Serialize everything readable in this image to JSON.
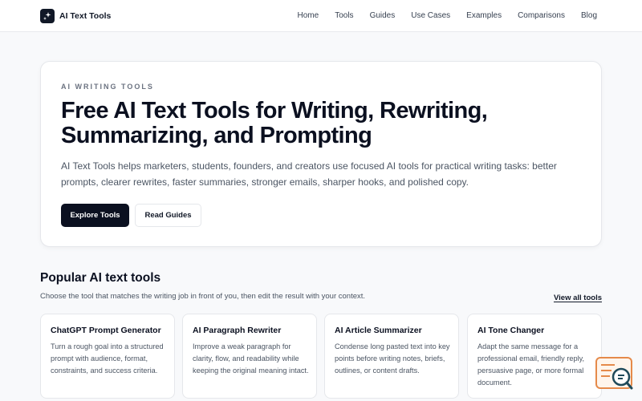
{
  "header": {
    "brand": "AI Text Tools",
    "nav": [
      "Home",
      "Tools",
      "Guides",
      "Use Cases",
      "Examples",
      "Comparisons",
      "Blog"
    ]
  },
  "hero": {
    "eyebrow": "AI WRITING TOOLS",
    "title": "Free AI Text Tools for Writing, Rewriting, Summarizing, and Prompting",
    "description": "AI Text Tools helps marketers, students, founders, and creators use focused AI tools for practical writing tasks: better prompts, clearer rewrites, faster summaries, stronger emails, sharper hooks, and polished copy.",
    "primary_button": "Explore Tools",
    "secondary_button": "Read Guides"
  },
  "popular": {
    "title": "Popular AI text tools",
    "description": "Choose the tool that matches the writing job in front of you, then edit the result with your context.",
    "view_all": "View all tools",
    "cards": [
      {
        "title": "ChatGPT Prompt Generator",
        "description": "Turn a rough goal into a structured prompt with audience, format, constraints, and success criteria."
      },
      {
        "title": "AI Paragraph Rewriter",
        "description": "Improve a weak paragraph for clarity, flow, and readability while keeping the original meaning intact."
      },
      {
        "title": "AI Article Summarizer",
        "description": "Condense long pasted text into key points before writing notes, briefs, outlines, or content drafts."
      },
      {
        "title": "AI Tone Changer",
        "description": "Adapt the same message for a professional email, friendly reply, persuasive page, or more formal document."
      }
    ]
  },
  "colors": {
    "primary": "#0b1020",
    "accent_widget": "#e58a4a",
    "background": "#f8f9fb"
  },
  "icons": {
    "logo": "sparkle-icon",
    "widget": "document-search-icon"
  }
}
